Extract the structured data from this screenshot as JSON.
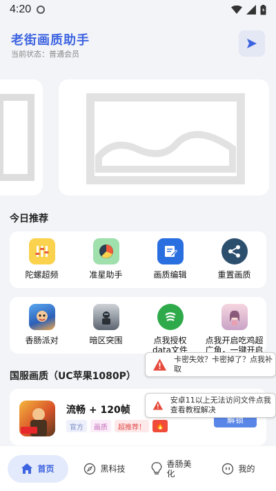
{
  "status_bar": {
    "time": "4:20"
  },
  "header": {
    "title": "老街画质助手",
    "status": "当前状态：普通会员"
  },
  "sections": {
    "today": "今日推荐",
    "cn_server": "国服画质（UC苹果1080P）"
  },
  "tools_row1": [
    {
      "label": "陀螺超频",
      "icon": "equalizer-icon",
      "color": "#fbd24e"
    },
    {
      "label": "准星助手",
      "icon": "crosshair-pie-icon",
      "color": "#9fe0ad"
    },
    {
      "label": "画质编辑",
      "icon": "edit-doc-icon",
      "color": "#2a6fe0"
    },
    {
      "label": "重置画质",
      "icon": "share-icon",
      "color": "#2c4f6e"
    }
  ],
  "tools_row2": [
    {
      "label": "香肠派对",
      "icon": "sausage-party-icon"
    },
    {
      "label": "暗区突围",
      "icon": "arena-breakout-icon"
    },
    {
      "label": "点我授权\ndata文件",
      "icon": "leaf-icon"
    },
    {
      "label": "点我开启吃鸡超\n广角，一键开启",
      "icon": "anime-girl-icon"
    }
  ],
  "toasts": [
    {
      "text": "卡密失效？卡密掉了？点我补取"
    },
    {
      "text": "安卓11以上无法访问文件点我查看教程解决"
    }
  ],
  "game": {
    "title": "流畅 + 120帧",
    "tags": [
      {
        "label": "官方",
        "bg": "#eef1fb",
        "color": "#7a8bc4"
      },
      {
        "label": "画质",
        "bg": "#fbeefa",
        "color": "#c46bb8"
      },
      {
        "label": "超推荐！",
        "bg": "#fde9e9",
        "color": "#e24b4b"
      },
      {
        "label": "🔥",
        "bg": "#f04c3c",
        "color": "#ffffff"
      }
    ],
    "button": "解锁"
  },
  "bottom_nav": [
    {
      "label": "首页",
      "icon": "home-icon",
      "active": true
    },
    {
      "label": "黑科技",
      "icon": "compass-icon",
      "active": false
    },
    {
      "label": "香肠美\n化",
      "icon": "bulb-icon",
      "active": false
    },
    {
      "label": "我的",
      "icon": "profile-icon",
      "active": false
    }
  ],
  "colors": {
    "accent": "#3c63e0",
    "background": "#f3f4f8"
  }
}
